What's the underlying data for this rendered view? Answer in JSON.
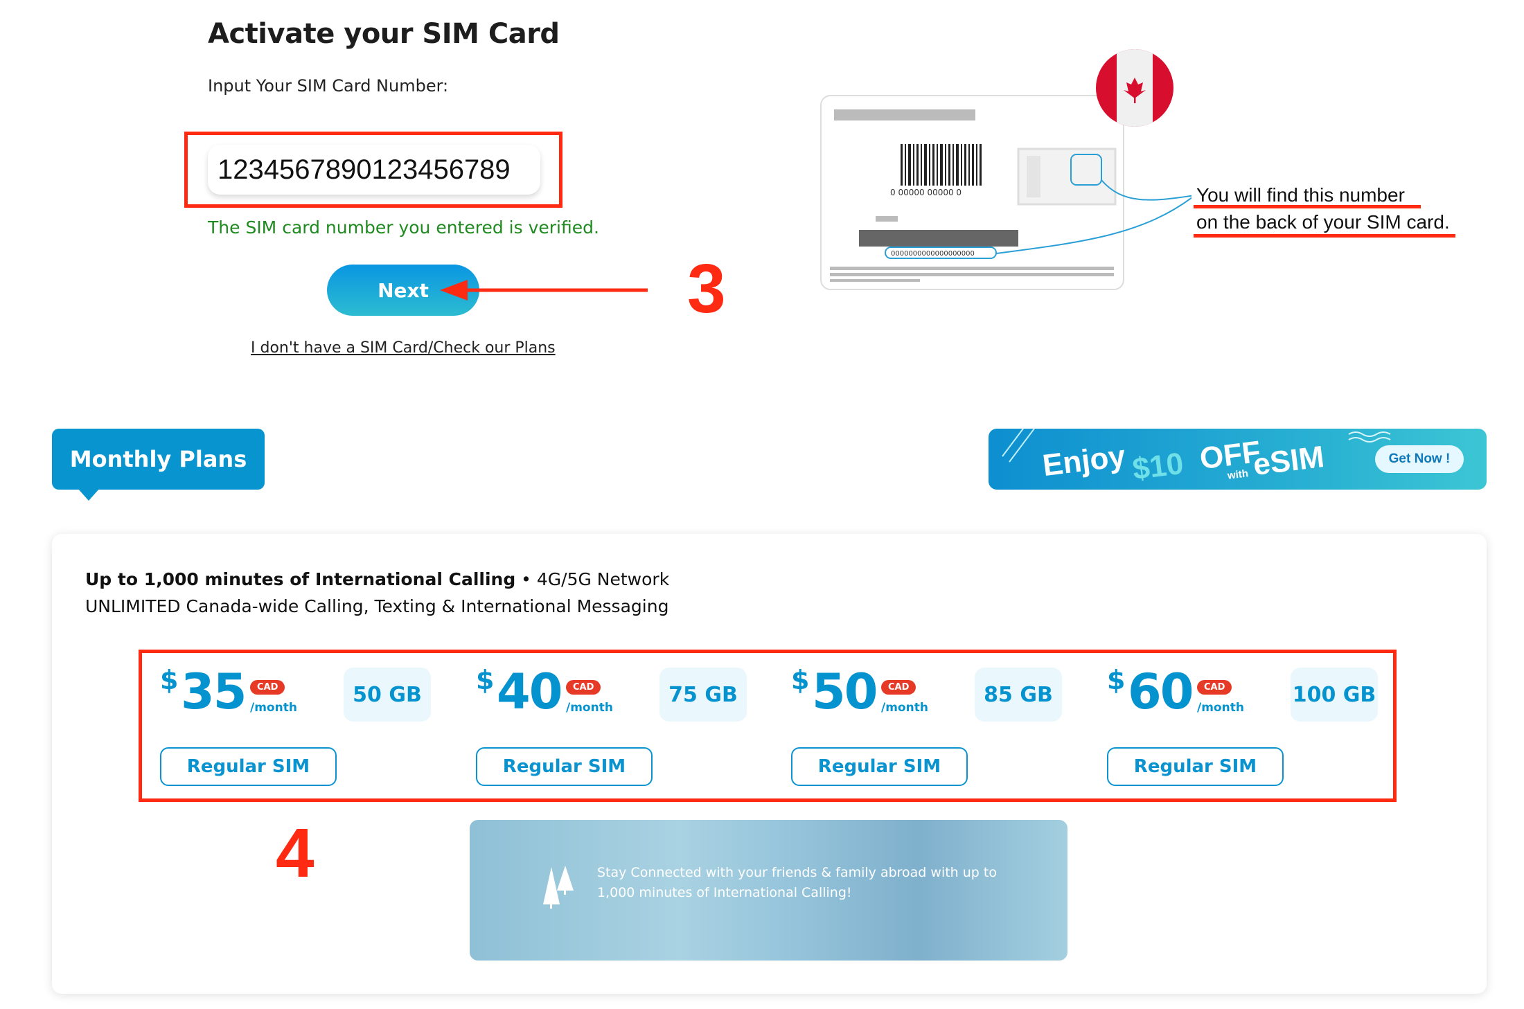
{
  "activation": {
    "title": "Activate your SIM Card",
    "input_label": "Input Your SIM Card Number:",
    "sim_number": "1234567890123456789",
    "verified_message": "The SIM card number you entered is verified.",
    "next_label": "Next",
    "no_sim_link": "I don't have a SIM Card/Check our Plans",
    "step_annotation": "3"
  },
  "sim_illustration": {
    "hint_line1": "You will find this number",
    "hint_line2": "on the back of your SIM card.",
    "barcode_digits": "0 00000 00000 0",
    "serial_placeholder": "0000000000000000000",
    "flag": "canada-flag-icon"
  },
  "plans_section": {
    "tab_label": "Monthly Plans",
    "promo": {
      "enjoy": "Enjoy",
      "amount": "$10",
      "off": "OFF",
      "with": "with",
      "esim": "eSIM",
      "cta": "Get Now !"
    },
    "feature_bold": "Up to 1,000 minutes of International Calling",
    "feature_network": " • 4G/5G Network",
    "feature_line2": "UNLIMITED Canada-wide Calling, Texting & International Messaging",
    "currency_symbol": "$",
    "currency_badge": "CAD",
    "period": "/month",
    "button_label": "Regular SIM",
    "plans": [
      {
        "price": "35",
        "data": "50 GB"
      },
      {
        "price": "40",
        "data": "75 GB"
      },
      {
        "price": "50",
        "data": "85 GB"
      },
      {
        "price": "60",
        "data": "100 GB"
      }
    ],
    "step_annotation": "4",
    "photo_banner_text": "Stay Connected with your friends & family abroad with up to 1,000 minutes of International Calling!"
  },
  "colors": {
    "brand": "#0894cf",
    "annotation": "#ff2a12",
    "verified": "#1f8a1f",
    "badge": "#e63a26"
  }
}
